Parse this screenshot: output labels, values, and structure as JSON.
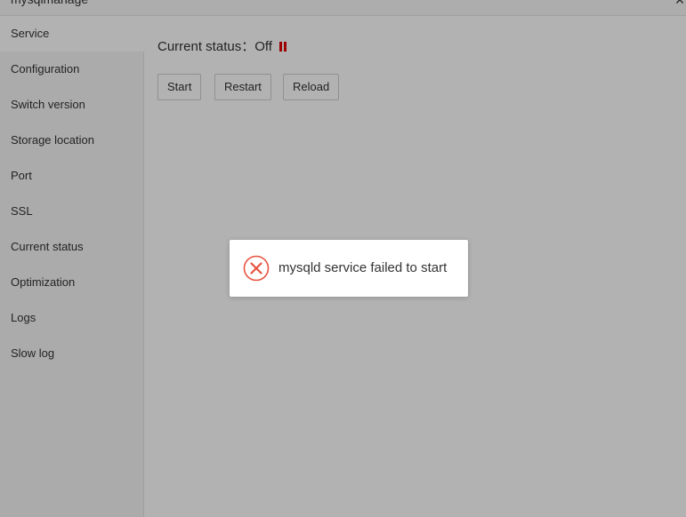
{
  "window": {
    "title": "mysqlmanage",
    "close_label": "×"
  },
  "sidebar": {
    "items": [
      {
        "label": "Service"
      },
      {
        "label": "Configuration"
      },
      {
        "label": "Switch version"
      },
      {
        "label": "Storage location"
      },
      {
        "label": "Port"
      },
      {
        "label": "SSL"
      },
      {
        "label": "Current status"
      },
      {
        "label": "Optimization"
      },
      {
        "label": "Logs"
      },
      {
        "label": "Slow log"
      }
    ],
    "active": "Service"
  },
  "main": {
    "status_label": "Current status",
    "status_separator": "：",
    "status_value": "Off",
    "buttons": {
      "start": "Start",
      "restart": "Restart",
      "reload": "Reload"
    }
  },
  "toast": {
    "message": "mysqld service failed to start",
    "icon": "error-circle-icon"
  },
  "colors": {
    "status_off": "#e00000",
    "error": "#e8523f",
    "overlay": "rgba(0,0,0,0.3)"
  }
}
